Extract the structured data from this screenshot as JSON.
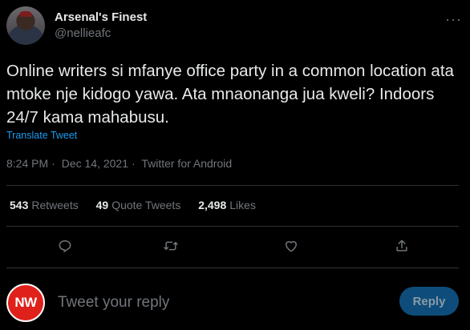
{
  "author": {
    "display_name": "Arsenal's Finest",
    "handle": "@nellieafc"
  },
  "tweet": {
    "text": "Online writers si mfanye office party in a common location ata mtoke nje kidogo yawa. Ata mnaonanga jua kweli? Indoors 24/7 kama mahabusu.",
    "translate_label": "Translate Tweet",
    "time": "8:24 PM",
    "date": "Dec 14, 2021",
    "source": "Twitter for Android",
    "separator": "·"
  },
  "stats": {
    "retweets_count": "543",
    "retweets_label": "Retweets",
    "quotes_count": "49",
    "quotes_label": "Quote Tweets",
    "likes_count": "2,498",
    "likes_label": "Likes"
  },
  "icons": {
    "more": "more-icon",
    "reply": "reply-icon",
    "retweet": "retweet-icon",
    "like": "like-icon",
    "share": "share-icon"
  },
  "reply_box": {
    "avatar_text": "NW",
    "placeholder": "Tweet your reply",
    "button_label": "Reply"
  },
  "colors": {
    "background": "#000000",
    "text": "#e7e9ea",
    "muted": "#71767b",
    "link": "#1d9bf0",
    "reply_button": "#0e4d7b",
    "nw_red": "#e0201b"
  }
}
